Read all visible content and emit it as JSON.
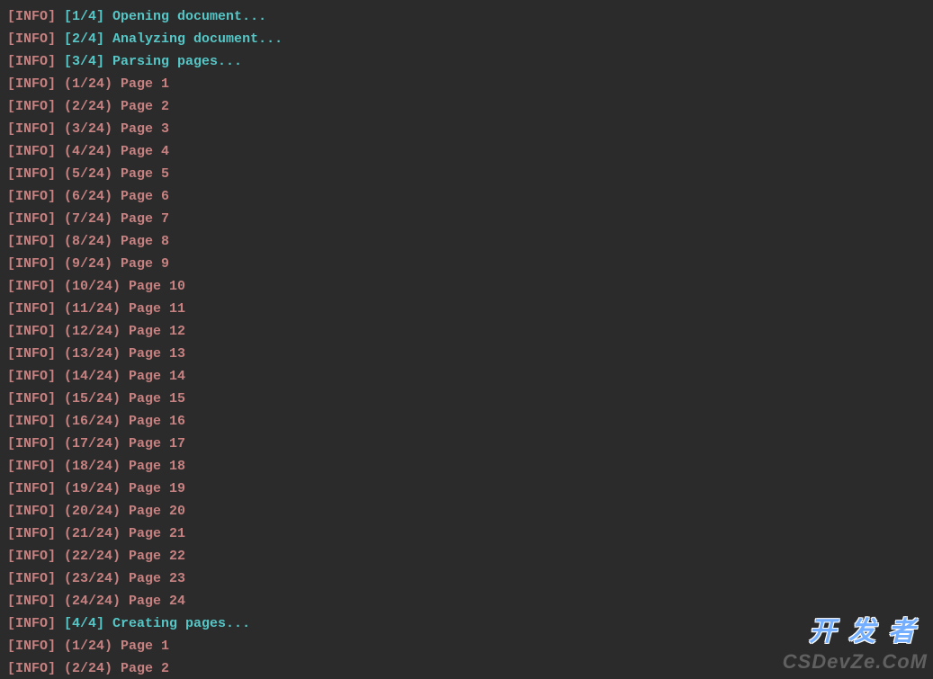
{
  "terminal": {
    "lines": [
      {
        "level": "[INFO]",
        "major": true,
        "msg": "[1/4] Opening document..."
      },
      {
        "level": "[INFO]",
        "major": true,
        "msg": "[2/4] Analyzing document..."
      },
      {
        "level": "[INFO]",
        "major": true,
        "msg": "[3/4] Parsing pages..."
      },
      {
        "level": "[INFO]",
        "major": false,
        "msg": "(1/24) Page 1"
      },
      {
        "level": "[INFO]",
        "major": false,
        "msg": "(2/24) Page 2"
      },
      {
        "level": "[INFO]",
        "major": false,
        "msg": "(3/24) Page 3"
      },
      {
        "level": "[INFO]",
        "major": false,
        "msg": "(4/24) Page 4"
      },
      {
        "level": "[INFO]",
        "major": false,
        "msg": "(5/24) Page 5"
      },
      {
        "level": "[INFO]",
        "major": false,
        "msg": "(6/24) Page 6"
      },
      {
        "level": "[INFO]",
        "major": false,
        "msg": "(7/24) Page 7"
      },
      {
        "level": "[INFO]",
        "major": false,
        "msg": "(8/24) Page 8"
      },
      {
        "level": "[INFO]",
        "major": false,
        "msg": "(9/24) Page 9"
      },
      {
        "level": "[INFO]",
        "major": false,
        "msg": "(10/24) Page 10"
      },
      {
        "level": "[INFO]",
        "major": false,
        "msg": "(11/24) Page 11"
      },
      {
        "level": "[INFO]",
        "major": false,
        "msg": "(12/24) Page 12"
      },
      {
        "level": "[INFO]",
        "major": false,
        "msg": "(13/24) Page 13"
      },
      {
        "level": "[INFO]",
        "major": false,
        "msg": "(14/24) Page 14"
      },
      {
        "level": "[INFO]",
        "major": false,
        "msg": "(15/24) Page 15"
      },
      {
        "level": "[INFO]",
        "major": false,
        "msg": "(16/24) Page 16"
      },
      {
        "level": "[INFO]",
        "major": false,
        "msg": "(17/24) Page 17"
      },
      {
        "level": "[INFO]",
        "major": false,
        "msg": "(18/24) Page 18"
      },
      {
        "level": "[INFO]",
        "major": false,
        "msg": "(19/24) Page 19"
      },
      {
        "level": "[INFO]",
        "major": false,
        "msg": "(20/24) Page 20"
      },
      {
        "level": "[INFO]",
        "major": false,
        "msg": "(21/24) Page 21"
      },
      {
        "level": "[INFO]",
        "major": false,
        "msg": "(22/24) Page 22"
      },
      {
        "level": "[INFO]",
        "major": false,
        "msg": "(23/24) Page 23"
      },
      {
        "level": "[INFO]",
        "major": false,
        "msg": "(24/24) Page 24"
      },
      {
        "level": "[INFO]",
        "major": true,
        "msg": "[4/4] Creating pages..."
      },
      {
        "level": "[INFO]",
        "major": false,
        "msg": "(1/24) Page 1"
      },
      {
        "level": "[INFO]",
        "major": false,
        "msg": "(2/24) Page 2"
      }
    ]
  },
  "watermark": {
    "cn": "开发者",
    "en": "CSDevZe.CoM"
  }
}
